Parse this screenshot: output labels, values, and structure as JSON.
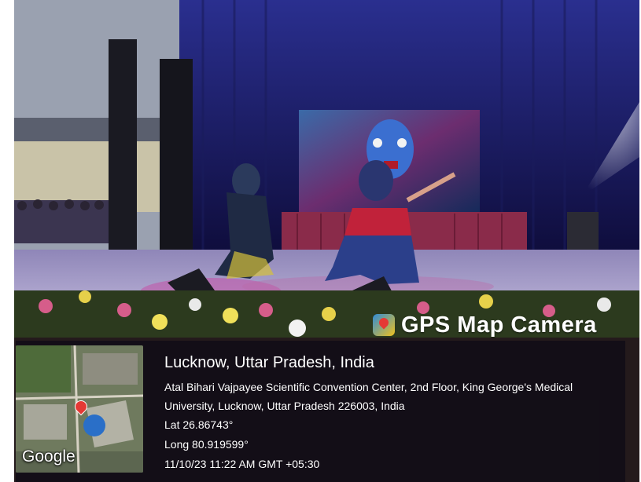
{
  "photo": {
    "description_icons": [
      "stage-scene"
    ],
    "watermark": {
      "icon": "map-pin-camera-icon",
      "text": "GPS Map Camera"
    }
  },
  "overlay": {
    "map_label": "Google",
    "map_pin_icon": "location-pin-icon",
    "city": "Lucknow, Uttar Pradesh, India",
    "address": "Atal Bihari Vajpayee Scientific Convention Center, 2nd Floor, King George's Medical University, Lucknow, Uttar Pradesh 226003, India",
    "lat": "Lat 26.86743°",
    "long": "Long 80.919599°",
    "timestamp": "11/10/23 11:22 AM GMT +05:30"
  }
}
